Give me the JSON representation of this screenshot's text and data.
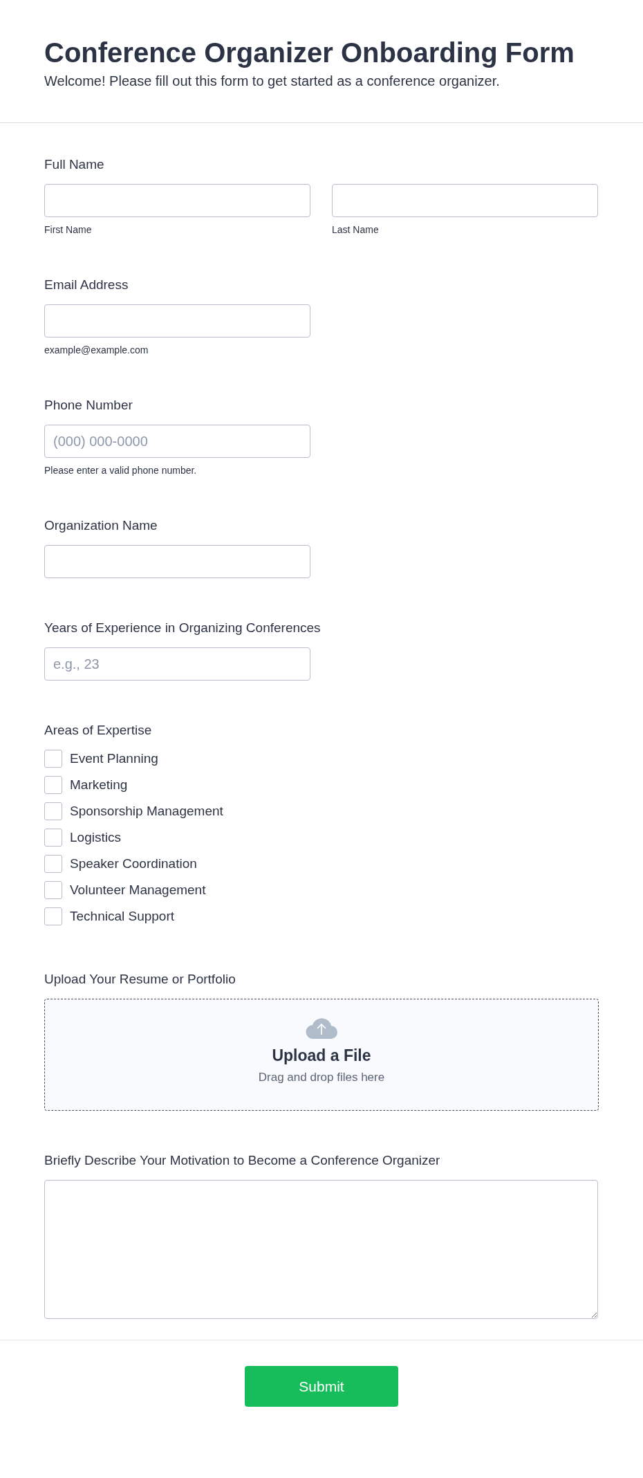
{
  "header": {
    "title": "Conference Organizer Onboarding Form",
    "subtitle": "Welcome! Please fill out this form to get started as a conference organizer."
  },
  "fields": [
    {
      "kind": "name",
      "label": "Full Name",
      "sublabels": [
        "First Name",
        "Last Name"
      ]
    },
    {
      "kind": "text",
      "label": "Email Address",
      "sublabel": "example@example.com"
    },
    {
      "kind": "text",
      "label": "Phone Number",
      "placeholder": "(000) 000-0000",
      "sublabel": "Please enter a valid phone number."
    },
    {
      "kind": "text",
      "label": "Organization Name"
    },
    {
      "kind": "text",
      "label": "Years of Experience in Organizing Conferences",
      "placeholder": "e.g., 23"
    },
    {
      "kind": "checkboxes",
      "label": "Areas of Expertise",
      "options": [
        {
          "label": "Event Planning",
          "checked": false
        },
        {
          "label": "Marketing",
          "checked": false
        },
        {
          "label": "Sponsorship Management",
          "checked": false
        },
        {
          "label": "Logistics",
          "checked": false
        },
        {
          "label": "Speaker Coordination",
          "checked": false
        },
        {
          "label": "Volunteer Management",
          "checked": false
        },
        {
          "label": "Technical Support",
          "checked": false
        }
      ]
    },
    {
      "kind": "upload",
      "label": "Upload Your Resume or Portfolio",
      "title": "Upload a File",
      "hint": "Drag and drop files here"
    },
    {
      "kind": "textarea",
      "label": "Briefly Describe Your Motivation to Become a Conference Organizer"
    }
  ],
  "submit": {
    "label": "Submit"
  }
}
